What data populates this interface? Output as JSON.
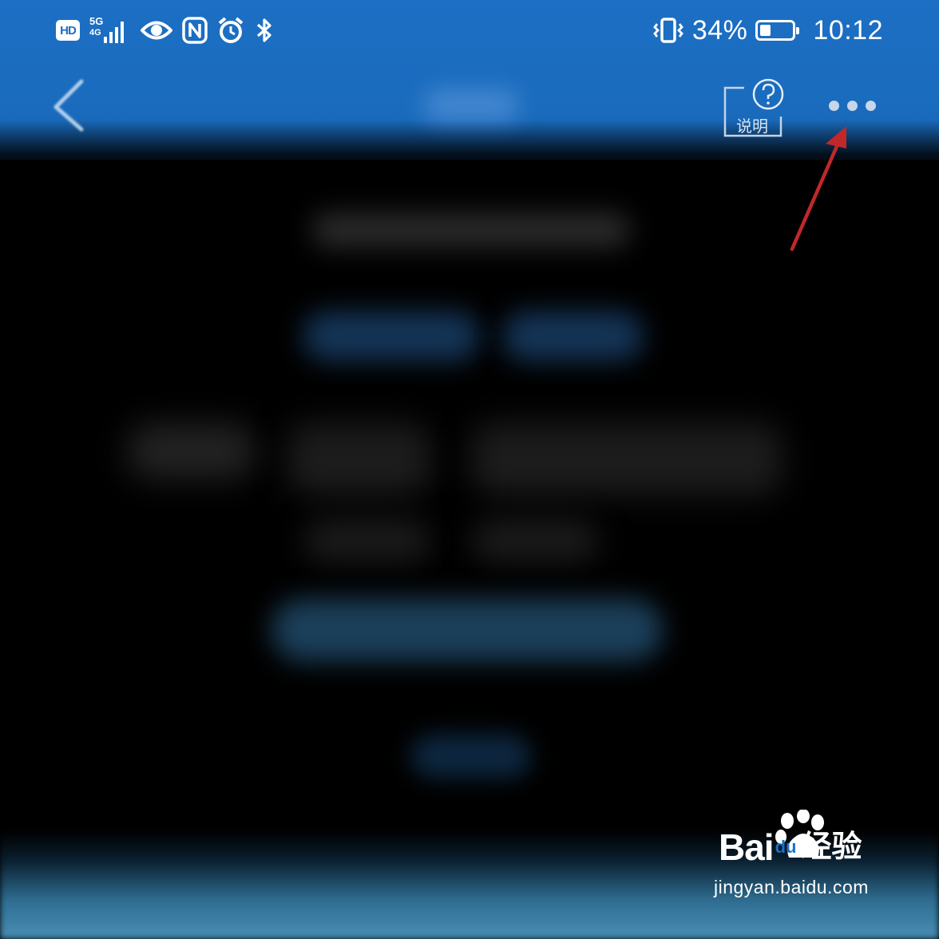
{
  "status_bar": {
    "hd_badge": "HD",
    "network_label": "5G",
    "network_sub_label": "4G",
    "battery_percent": "34%",
    "battery_level": 0.34,
    "time": "10:12",
    "icons": [
      "hd-icon",
      "signal-icon",
      "eye-icon",
      "nfc-icon",
      "alarm-icon",
      "bluetooth-icon",
      "vibrate-icon",
      "battery-icon"
    ]
  },
  "header": {
    "help_label": "说明",
    "back_icon": "chevron-left-icon",
    "more_icon": "more-dots-icon",
    "help_icon": "question-icon"
  },
  "annotation": {
    "arrow_color": "#c0282a"
  },
  "watermark": {
    "brand_bai": "Bai",
    "brand_du": "du",
    "brand_cn": "经验",
    "url": "jingyan.baidu.com"
  },
  "colors": {
    "header_blue": "#1c6fc4",
    "content_bg": "#000000",
    "arrow": "#c0282a"
  }
}
